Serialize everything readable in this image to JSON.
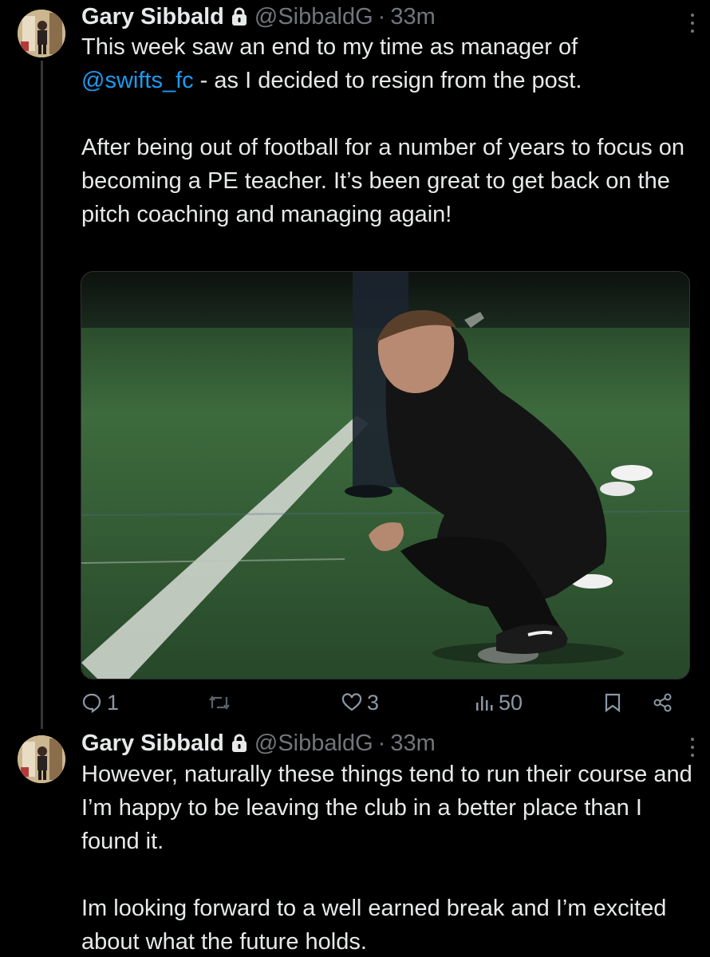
{
  "tweets": [
    {
      "author": {
        "name": "Gary Sibbald",
        "handle": "@SibbaldG",
        "separator": "·",
        "time": "33m"
      },
      "text": {
        "line1": "This week saw an end to my time as manager of",
        "mention": "@swifts_fc",
        "line2_rest": " - as I decided to resign from the post.",
        "paragraph2": "After being out of football for a number of years to focus on becoming a PE teacher. It’s been great to get back on the pitch coaching and managing again!"
      },
      "stats": {
        "replies": "1",
        "likes": "3",
        "views": "50"
      }
    },
    {
      "author": {
        "name": "Gary Sibbald",
        "handle": "@SibbaldG",
        "separator": "·",
        "time": "33m"
      },
      "text": {
        "paragraph1": "However, naturally these things tend to run their course and I’m happy to be leaving the club in a better place than I found it.",
        "paragraph2": "Im looking forward to a well earned break and I’m excited about what the future holds."
      }
    }
  ],
  "icons": {
    "lock": "lock-icon",
    "more": "more-vertical-icon",
    "reply": "reply-icon",
    "retweet": "retweet-icon",
    "like": "heart-icon",
    "views": "views-chart-icon",
    "bookmark": "bookmark-icon",
    "share": "share-icon"
  },
  "colors": {
    "background": "#000000",
    "text": "#e7e9ea",
    "muted": "#71767b",
    "link": "#1d9bf0"
  }
}
